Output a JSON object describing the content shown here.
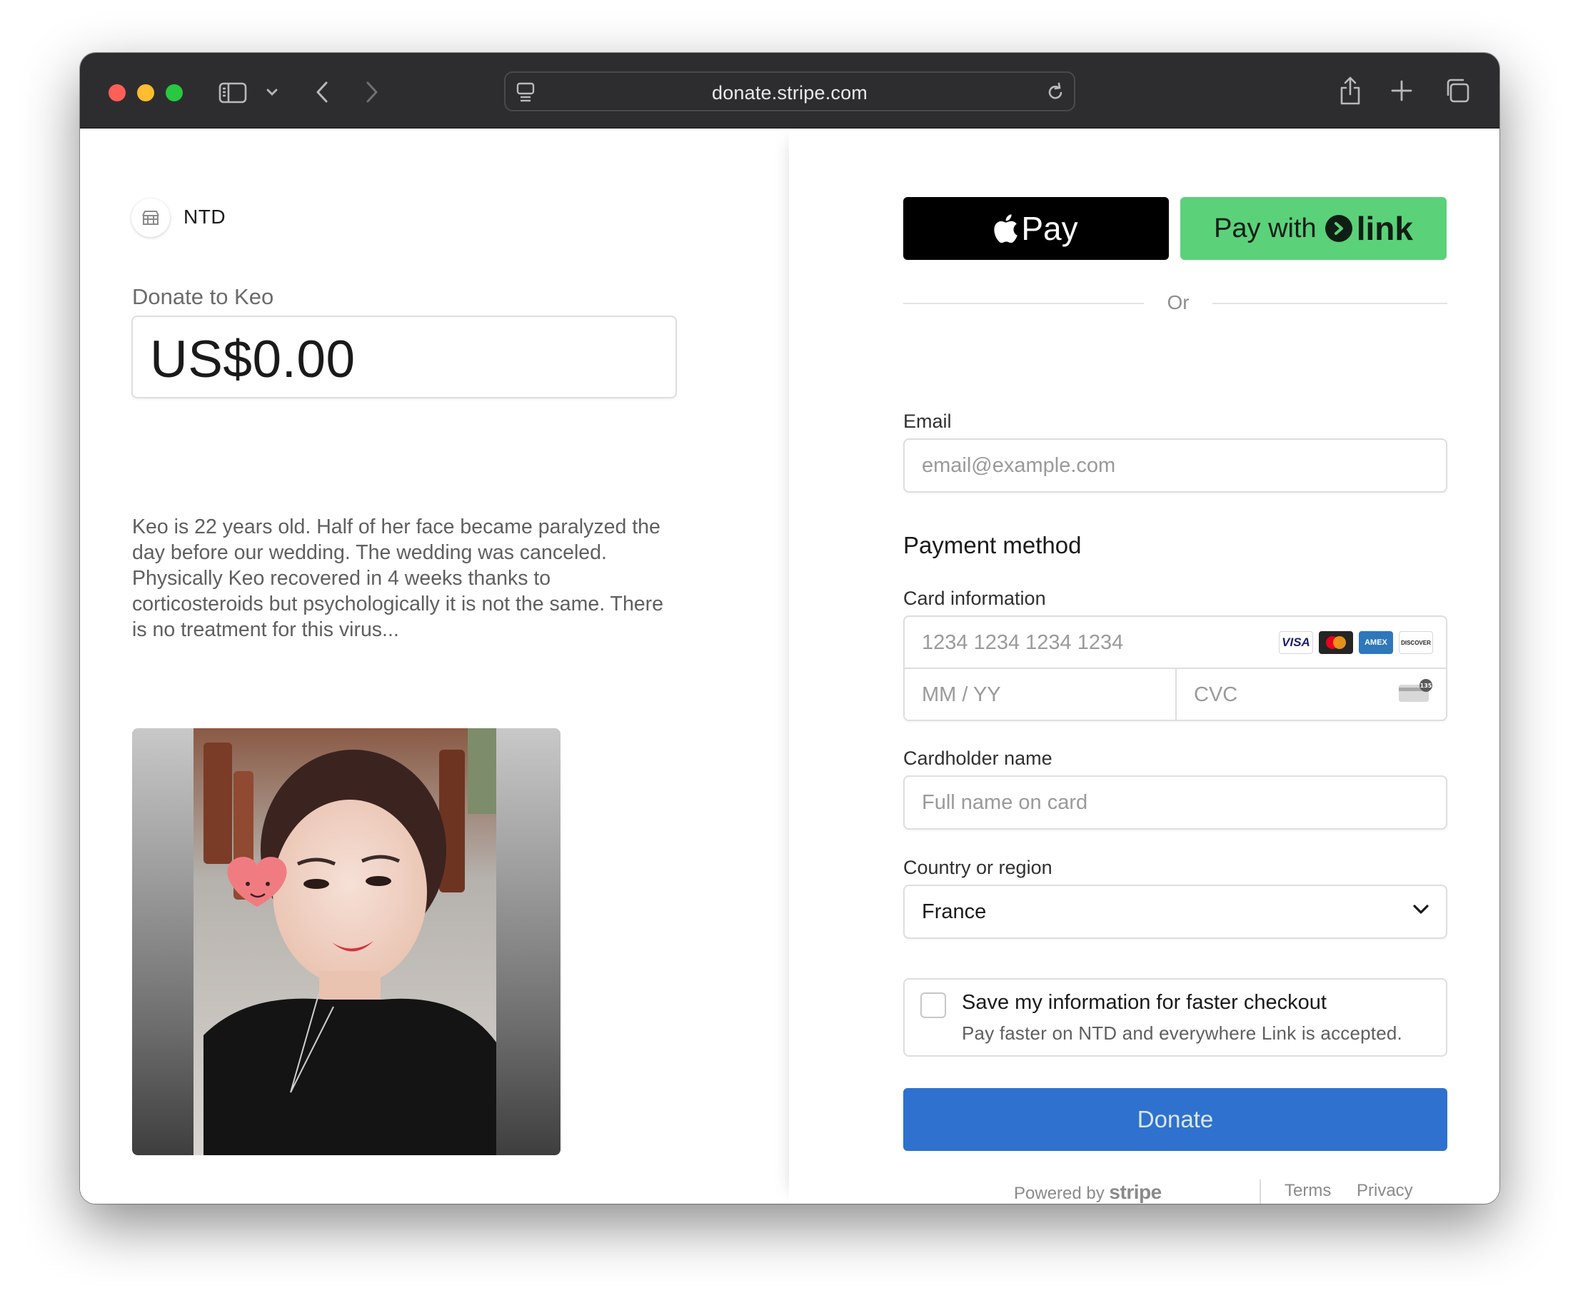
{
  "browser": {
    "url": "donate.stripe.com"
  },
  "merchant": {
    "name": "NTD"
  },
  "donation": {
    "label": "Donate to Keo",
    "amount": "US$0.00",
    "description": "Keo is 22 years old. Half of her face became paralyzed the day before our wedding. The wedding was canceled. Physically Keo recovered in 4 weeks thanks to corticosteroids but psychologically it is not the same. There is no treatment for this virus..."
  },
  "payment": {
    "apple_pay_label": "Pay",
    "link_prefix": "Pay with",
    "link_word": "link",
    "or_label": "Or",
    "email_label": "Email",
    "email_placeholder": "email@example.com",
    "payment_method_title": "Payment method",
    "card_info_label": "Card information",
    "card_number_placeholder": "1234 1234 1234 1234",
    "expiry_placeholder": "MM / YY",
    "cvc_placeholder": "CVC",
    "cvc_badge": "135",
    "card_brands": [
      "VISA",
      "mastercard",
      "AMEX",
      "DISCOVER"
    ],
    "cardholder_label": "Cardholder name",
    "cardholder_placeholder": "Full name on card",
    "country_label": "Country or region",
    "country_value": "France",
    "save_title": "Save my information for faster checkout",
    "save_subtitle": "Pay faster on NTD and everywhere Link is accepted.",
    "save_checked": false,
    "donate_button": "Donate"
  },
  "footer": {
    "powered_by": "Powered by",
    "stripe": "stripe",
    "terms": "Terms",
    "privacy": "Privacy"
  },
  "colors": {
    "toolbar": "#2d2d2f",
    "apple_pay": "#000000",
    "link_green": "#5bd17a",
    "donate_blue": "#2f71ce"
  }
}
